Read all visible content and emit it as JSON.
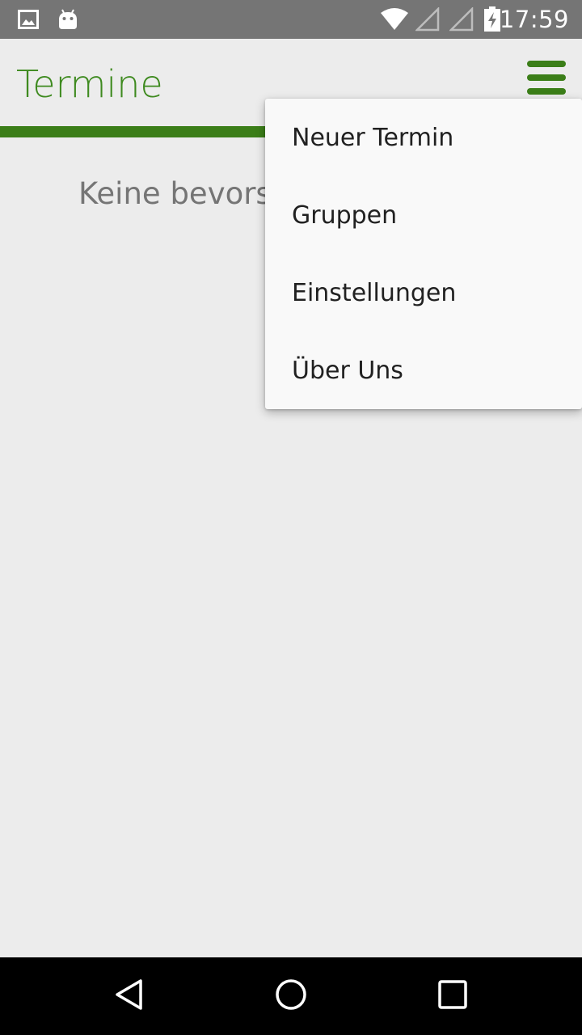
{
  "status_bar": {
    "time": "17:59",
    "icons": [
      "gallery-icon",
      "android-icon",
      "wifi-icon",
      "signal-icon",
      "signal-icon",
      "battery-charging-icon"
    ]
  },
  "app_bar": {
    "title": "Termine",
    "menu_icon": "hamburger-menu-icon",
    "accent_color": "#3e8a1f"
  },
  "main": {
    "empty_message": "Keine bevorst"
  },
  "overflow_menu": {
    "items": [
      {
        "label": "Neuer Termin"
      },
      {
        "label": "Gruppen"
      },
      {
        "label": "Einstellungen"
      },
      {
        "label": "Über Uns"
      }
    ]
  },
  "nav_bar": {
    "icons": [
      "back-icon",
      "home-icon",
      "recents-icon"
    ]
  }
}
